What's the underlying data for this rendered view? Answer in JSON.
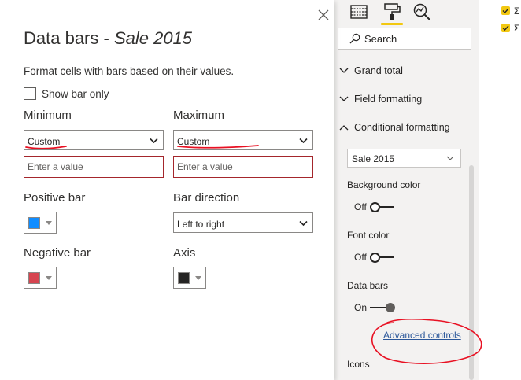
{
  "dialog": {
    "title_main": "Data bars - ",
    "title_field": "Sale 2015",
    "description": "Format cells with bars based on their values.",
    "show_bar_only_label": "Show bar only",
    "minimum_label": "Minimum",
    "maximum_label": "Maximum",
    "minimum_value": "Custom",
    "maximum_value": "Custom",
    "minimum_placeholder": "Enter a value",
    "maximum_placeholder": "Enter a value",
    "positive_bar_label": "Positive bar",
    "bar_direction_label": "Bar direction",
    "bar_direction_value": "Left to right",
    "negative_bar_label": "Negative bar",
    "axis_label": "Axis",
    "colors": {
      "positive": "#118dff",
      "negative": "#d64550",
      "axis": "#252423"
    }
  },
  "pane": {
    "search_placeholder": "Search",
    "sections": [
      "Grand total",
      "Field formatting",
      "Conditional formatting"
    ],
    "field_select_value": "Sale 2015",
    "background_color_label": "Background color",
    "background_color_state": "Off",
    "font_color_label": "Font color",
    "font_color_state": "Off",
    "data_bars_label": "Data bars",
    "data_bars_state": "On",
    "advanced_controls_label": "Advanced controls",
    "icons_label": "Icons",
    "accent_color": "#f2c811"
  },
  "fields": {
    "items": [
      "Σ",
      "Σ"
    ]
  }
}
